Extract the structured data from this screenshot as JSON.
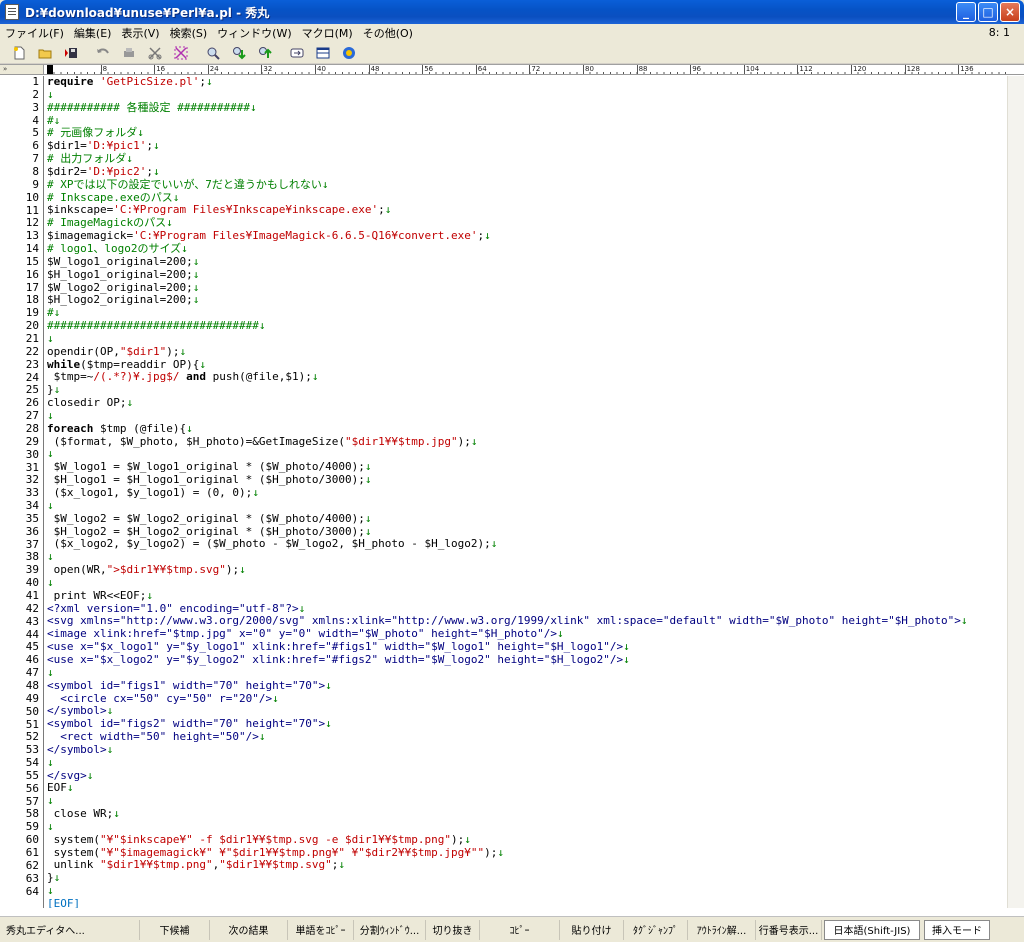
{
  "window": {
    "title": "D:¥download¥unuse¥Perl¥a.pl - 秀丸",
    "minimize": "_",
    "maximize": "□",
    "close": "×"
  },
  "menu": [
    "ファイル(F)",
    "編集(E)",
    "表示(V)",
    "検索(S)",
    "ウィンドウ(W)",
    "マクロ(M)",
    "その他(O)"
  ],
  "cursor_position": "8: 1",
  "toolbar": [
    "new-file-icon",
    "open-folder-icon",
    "save-icon",
    "undo-icon",
    "redo-icon",
    "cut-icon",
    "copy-icon",
    "find-icon",
    "find-prev-icon",
    "find-next-icon",
    "replace-icon",
    "split-window-icon",
    "macro-icon"
  ],
  "ruler": {
    "gutter_label": "»",
    "ticks": [
      "0",
      "8",
      "16",
      "24",
      "32",
      "40",
      "48",
      "56",
      "64",
      "72",
      "80",
      "88",
      "96",
      "104",
      "112",
      "120",
      "128",
      "136"
    ]
  },
  "code": [
    [
      [
        "k",
        "require "
      ],
      [
        "s",
        "'GetPicSize.pl'"
      ],
      [
        "p",
        ";"
      ],
      [
        "m",
        "↓"
      ]
    ],
    [
      [
        "m",
        "↓"
      ]
    ],
    [
      [
        "c",
        "########### 各種設定 ###########"
      ],
      [
        "m",
        "↓"
      ]
    ],
    [
      [
        "c",
        "#"
      ],
      [
        "m",
        "↓"
      ]
    ],
    [
      [
        "c",
        "# 元画像フォルダ"
      ],
      [
        "m",
        "↓"
      ]
    ],
    [
      [
        "p",
        "$dir1="
      ],
      [
        "s",
        "'D:¥pic1'"
      ],
      [
        "p",
        ";"
      ],
      [
        "m",
        "↓"
      ]
    ],
    [
      [
        "c",
        "# 出力フォルダ"
      ],
      [
        "m",
        "↓"
      ]
    ],
    [
      [
        "p",
        "$dir2="
      ],
      [
        "s",
        "'D:¥pic2'"
      ],
      [
        "p",
        ";"
      ],
      [
        "m",
        "↓"
      ]
    ],
    [
      [
        "c",
        "# XPでは以下の設定でいいが、7だと違うかもしれない"
      ],
      [
        "m",
        "↓"
      ]
    ],
    [
      [
        "c",
        "# Inkscape.exeのパス"
      ],
      [
        "m",
        "↓"
      ]
    ],
    [
      [
        "p",
        "$inkscape="
      ],
      [
        "s",
        "'C:¥Program Files¥Inkscape¥inkscape.exe'"
      ],
      [
        "p",
        ";"
      ],
      [
        "m",
        "↓"
      ]
    ],
    [
      [
        "c",
        "# ImageMagickのパス"
      ],
      [
        "m",
        "↓"
      ]
    ],
    [
      [
        "p",
        "$imagemagick="
      ],
      [
        "s",
        "'C:¥Program Files¥ImageMagick-6.6.5-Q16¥convert.exe'"
      ],
      [
        "p",
        ";"
      ],
      [
        "m",
        "↓"
      ]
    ],
    [
      [
        "c",
        "# logo1、logo2のサイズ"
      ],
      [
        "m",
        "↓"
      ]
    ],
    [
      [
        "p",
        "$W_logo1_original=200;"
      ],
      [
        "m",
        "↓"
      ]
    ],
    [
      [
        "p",
        "$H_logo1_original=200;"
      ],
      [
        "m",
        "↓"
      ]
    ],
    [
      [
        "p",
        "$W_logo2_original=200;"
      ],
      [
        "m",
        "↓"
      ]
    ],
    [
      [
        "p",
        "$H_logo2_original=200;"
      ],
      [
        "m",
        "↓"
      ]
    ],
    [
      [
        "c",
        "#"
      ],
      [
        "m",
        "↓"
      ]
    ],
    [
      [
        "c",
        "################################"
      ],
      [
        "m",
        "↓"
      ]
    ],
    [
      [
        "m",
        "↓"
      ]
    ],
    [
      [
        "p",
        "opendir(OP,"
      ],
      [
        "s",
        "\"$dir1\""
      ],
      [
        "p",
        ");"
      ],
      [
        "m",
        "↓"
      ]
    ],
    [
      [
        "k",
        "while"
      ],
      [
        "p",
        "($tmp=readdir OP){"
      ],
      [
        "m",
        "↓"
      ]
    ],
    [
      [
        "p",
        " $tmp=~"
      ],
      [
        "s",
        "/(.*?)¥.jpg$/"
      ],
      [
        "p",
        " "
      ],
      [
        "k",
        "and"
      ],
      [
        "p",
        " push(@file,$1);"
      ],
      [
        "m",
        "↓"
      ]
    ],
    [
      [
        "p",
        "}"
      ],
      [
        "m",
        "↓"
      ]
    ],
    [
      [
        "p",
        "closedir OP;"
      ],
      [
        "m",
        "↓"
      ]
    ],
    [
      [
        "m",
        "↓"
      ]
    ],
    [
      [
        "k",
        "foreach"
      ],
      [
        "p",
        " $tmp (@file){"
      ],
      [
        "m",
        "↓"
      ]
    ],
    [
      [
        "p",
        " ($format, $W_photo, $H_photo)=&GetImageSize("
      ],
      [
        "s",
        "\"$dir1¥¥$tmp.jpg\""
      ],
      [
        "p",
        ");"
      ],
      [
        "m",
        "↓"
      ]
    ],
    [
      [
        "m",
        "↓"
      ]
    ],
    [
      [
        "p",
        " $W_logo1 = $W_logo1_original * ($W_photo/4000);"
      ],
      [
        "m",
        "↓"
      ]
    ],
    [
      [
        "p",
        " $H_logo1 = $H_logo1_original * ($H_photo/3000);"
      ],
      [
        "m",
        "↓"
      ]
    ],
    [
      [
        "p",
        " ($x_logo1, $y_logo1) = (0, 0);"
      ],
      [
        "m",
        "↓"
      ]
    ],
    [
      [
        "m",
        "↓"
      ]
    ],
    [
      [
        "p",
        " $W_logo2 = $W_logo2_original * ($W_photo/4000);"
      ],
      [
        "m",
        "↓"
      ]
    ],
    [
      [
        "p",
        " $H_logo2 = $H_logo2_original * ($H_photo/3000);"
      ],
      [
        "m",
        "↓"
      ]
    ],
    [
      [
        "p",
        " ($x_logo2, $y_logo2) = ($W_photo - $W_logo2, $H_photo - $H_logo2);"
      ],
      [
        "m",
        "↓"
      ]
    ],
    [
      [
        "m",
        "↓"
      ]
    ],
    [
      [
        "p",
        " open(WR,"
      ],
      [
        "s",
        "\">$dir1¥¥$tmp.svg\""
      ],
      [
        "p",
        ");"
      ],
      [
        "m",
        "↓"
      ]
    ],
    [
      [
        "m",
        "↓"
      ]
    ],
    [
      [
        "p",
        " print WR<<EOF;"
      ],
      [
        "m",
        "↓"
      ]
    ],
    [
      [
        "e",
        "<?xml version=\"1.0\" encoding=\"utf-8\"?>"
      ],
      [
        "m",
        "↓"
      ]
    ],
    [
      [
        "e",
        "<svg xmlns=\"http://www.w3.org/2000/svg\" xmlns:xlink=\"http://www.w3.org/1999/xlink\" xml:space=\"default\" width=\"$W_photo\" height=\"$H_photo\">"
      ],
      [
        "m",
        "↓"
      ]
    ],
    [
      [
        "e",
        "<image xlink:href=\"$tmp.jpg\" x=\"0\" y=\"0\" width=\"$W_photo\" height=\"$H_photo\"/>"
      ],
      [
        "m",
        "↓"
      ]
    ],
    [
      [
        "e",
        "<use x=\"$x_logo1\" y=\"$y_logo1\" xlink:href=\"#figs1\" width=\"$W_logo1\" height=\"$H_logo1\"/>"
      ],
      [
        "m",
        "↓"
      ]
    ],
    [
      [
        "e",
        "<use x=\"$x_logo2\" y=\"$y_logo2\" xlink:href=\"#figs2\" width=\"$W_logo2\" height=\"$H_logo2\"/>"
      ],
      [
        "m",
        "↓"
      ]
    ],
    [
      [
        "m",
        "↓"
      ]
    ],
    [
      [
        "e",
        "<symbol id=\"figs1\" width=\"70\" height=\"70\">"
      ],
      [
        "m",
        "↓"
      ]
    ],
    [
      [
        "e",
        "  <circle cx=\"50\" cy=\"50\" r=\"20\"/>"
      ],
      [
        "m",
        "↓"
      ]
    ],
    [
      [
        "e",
        "</symbol>"
      ],
      [
        "m",
        "↓"
      ]
    ],
    [
      [
        "e",
        "<symbol id=\"figs2\" width=\"70\" height=\"70\">"
      ],
      [
        "m",
        "↓"
      ]
    ],
    [
      [
        "e",
        "  <rect width=\"50\" height=\"50\"/>"
      ],
      [
        "m",
        "↓"
      ]
    ],
    [
      [
        "e",
        "</symbol>"
      ],
      [
        "m",
        "↓"
      ]
    ],
    [
      [
        "m",
        "↓"
      ]
    ],
    [
      [
        "e",
        "</svg>"
      ],
      [
        "m",
        "↓"
      ]
    ],
    [
      [
        "p",
        "EOF"
      ],
      [
        "m",
        "↓"
      ]
    ],
    [
      [
        "m",
        "↓"
      ]
    ],
    [
      [
        "p",
        " close WR;"
      ],
      [
        "m",
        "↓"
      ]
    ],
    [
      [
        "m",
        "↓"
      ]
    ],
    [
      [
        "p",
        " system("
      ],
      [
        "s",
        "\"¥\"$inkscape¥\" -f $dir1¥¥$tmp.svg -e $dir1¥¥$tmp.png\""
      ],
      [
        "p",
        ");"
      ],
      [
        "m",
        "↓"
      ]
    ],
    [
      [
        "p",
        " system("
      ],
      [
        "s",
        "\"¥\"$imagemagick¥\" ¥\"$dir1¥¥$tmp.png¥\" ¥\"$dir2¥¥$tmp.jpg¥\"\""
      ],
      [
        "p",
        ");"
      ],
      [
        "m",
        "↓"
      ]
    ],
    [
      [
        "p",
        " unlink "
      ],
      [
        "s",
        "\"$dir1¥¥$tmp.png\""
      ],
      [
        "p",
        ","
      ],
      [
        "s",
        "\"$dir1¥¥$tmp.svg\""
      ],
      [
        "p",
        ";"
      ],
      [
        "m",
        "↓"
      ]
    ],
    [
      [
        "p",
        "}"
      ],
      [
        "m",
        "↓"
      ]
    ],
    [
      [
        "m",
        "↓"
      ]
    ],
    [
      [
        "n",
        "[EOF]"
      ]
    ]
  ],
  "status": {
    "app": "秀丸エディタへ...",
    "cells": [
      "下候補",
      "次の結果",
      "単語をｺﾋﾟｰ",
      "分割ｳｨﾝﾄﾞｳ...",
      "切り抜き",
      "ｺﾋﾟｰ",
      "貼り付け",
      "ﾀｸﾞｼﾞｬﾝﾌﾟ",
      "ｱｳﾄﾗｲﾝ解...",
      "行番号表示..."
    ],
    "encoding": "日本語(Shift-JIS)",
    "mode": "挿入モード"
  },
  "colors": {
    "keyword": "#000000",
    "string": "#c00000",
    "comment": "#008000",
    "embedded": "#000080",
    "eof": "#0070c0",
    "titlebar": "#0653c6"
  }
}
